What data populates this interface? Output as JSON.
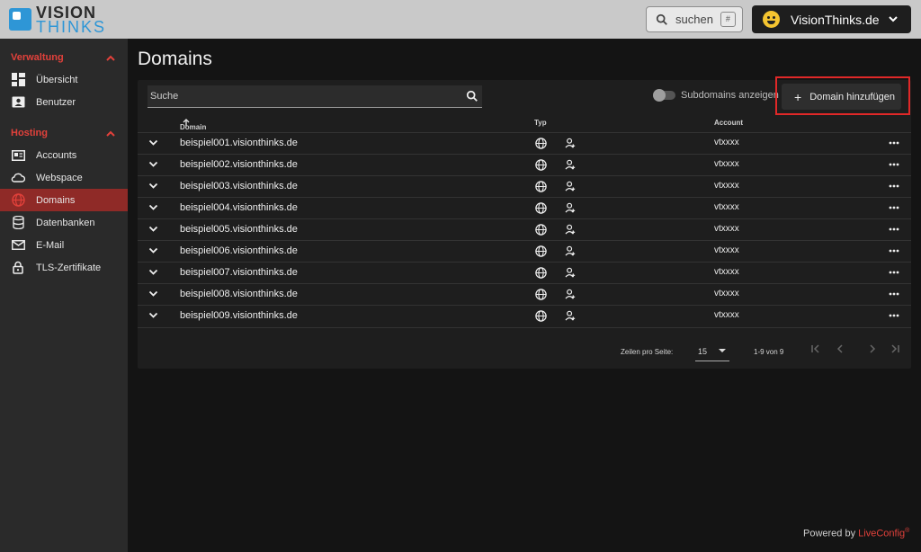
{
  "logo": {
    "line1": "VISION",
    "line2": "THINKS"
  },
  "header": {
    "search_label": "suchen",
    "search_shortcut": "#",
    "account_name": "VisionThinks.de"
  },
  "sidebar": {
    "sections": [
      {
        "title": "Verwaltung",
        "items": [
          {
            "label": "Übersicht",
            "icon": "dashboard-icon"
          },
          {
            "label": "Benutzer",
            "icon": "user-card-icon"
          }
        ]
      },
      {
        "title": "Hosting",
        "items": [
          {
            "label": "Accounts",
            "icon": "id-card-icon"
          },
          {
            "label": "Webspace",
            "icon": "cloud-icon"
          },
          {
            "label": "Domains",
            "icon": "globe-icon",
            "active": true
          },
          {
            "label": "Datenbanken",
            "icon": "database-icon"
          },
          {
            "label": "E-Mail",
            "icon": "mail-icon"
          },
          {
            "label": "TLS-Zertifikate",
            "icon": "lock-icon"
          }
        ]
      }
    ]
  },
  "page": {
    "title": "Domains"
  },
  "toolbar": {
    "search_placeholder": "Suche",
    "subdomains_label": "Subdomains anzeigen",
    "add_label": "Domain hinzufügen"
  },
  "table": {
    "columns": {
      "domain": "Domain",
      "type": "Typ",
      "account": "Account"
    },
    "rows": [
      {
        "domain": "beispiel001.visionthinks.de",
        "account": "vtxxxx"
      },
      {
        "domain": "beispiel002.visionthinks.de",
        "account": "vtxxxx"
      },
      {
        "domain": "beispiel003.visionthinks.de",
        "account": "vtxxxx"
      },
      {
        "domain": "beispiel004.visionthinks.de",
        "account": "vtxxxx"
      },
      {
        "domain": "beispiel005.visionthinks.de",
        "account": "vtxxxx"
      },
      {
        "domain": "beispiel006.visionthinks.de",
        "account": "vtxxxx"
      },
      {
        "domain": "beispiel007.visionthinks.de",
        "account": "vtxxxx"
      },
      {
        "domain": "beispiel008.visionthinks.de",
        "account": "vtxxxx"
      },
      {
        "domain": "beispiel009.visionthinks.de",
        "account": "vtxxxx"
      }
    ]
  },
  "pagination": {
    "rows_per_page_label": "Zeilen pro Seite:",
    "rows_per_page": "15",
    "range": "1-9 von 9"
  },
  "footer": {
    "powered_by": "Powered by",
    "brand": "LiveConfig",
    "reg": "®"
  },
  "colors": {
    "accent": "#e2413b",
    "brand_blue": "#2e96d6",
    "active_nav": "#8f2a27"
  }
}
